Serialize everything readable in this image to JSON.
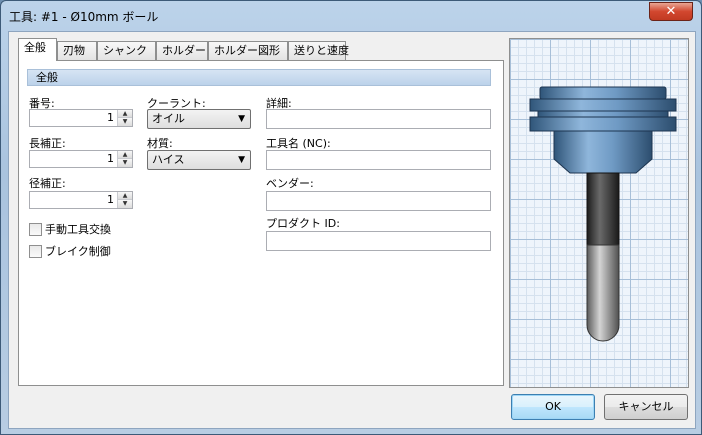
{
  "window": {
    "title": "工具: #1 - Ø10mm ボール",
    "close_label": "✕"
  },
  "tabs": [
    {
      "label": "全般"
    },
    {
      "label": "刃物"
    },
    {
      "label": "シャンク"
    },
    {
      "label": "ホルダー"
    },
    {
      "label": "ホルダー図形"
    },
    {
      "label": "送りと速度"
    }
  ],
  "general": {
    "section_title": "全般",
    "number": {
      "label": "番号:",
      "value": "1"
    },
    "length_offset": {
      "label": "長補正:",
      "value": "1"
    },
    "diameter_offset": {
      "label": "径補正:",
      "value": "1"
    },
    "coolant": {
      "label": "クーラント:",
      "selected": "オイル"
    },
    "material": {
      "label": "材質:",
      "selected": "ハイス"
    },
    "manual_tool_change": {
      "label": "手動工具交換",
      "checked": false
    },
    "break_control": {
      "label": "ブレイク制御",
      "checked": false
    },
    "comment": {
      "label": "詳細:",
      "value": ""
    },
    "tool_name_nc": {
      "label": "工具名 (NC):",
      "value": ""
    },
    "vendor": {
      "label": "ベンダー:",
      "value": ""
    },
    "product_id": {
      "label": "プロダクト ID:",
      "value": ""
    }
  },
  "buttons": {
    "ok": "OK",
    "cancel": "キャンセル"
  },
  "icons": {
    "spin_up": "spin-up-icon",
    "spin_down": "spin-down-icon",
    "dropdown": "chevron-down-icon"
  },
  "colors": {
    "tool_body": "#6f9ac4",
    "shank": "#3a3a3a",
    "grid": "#a7bfd8"
  }
}
